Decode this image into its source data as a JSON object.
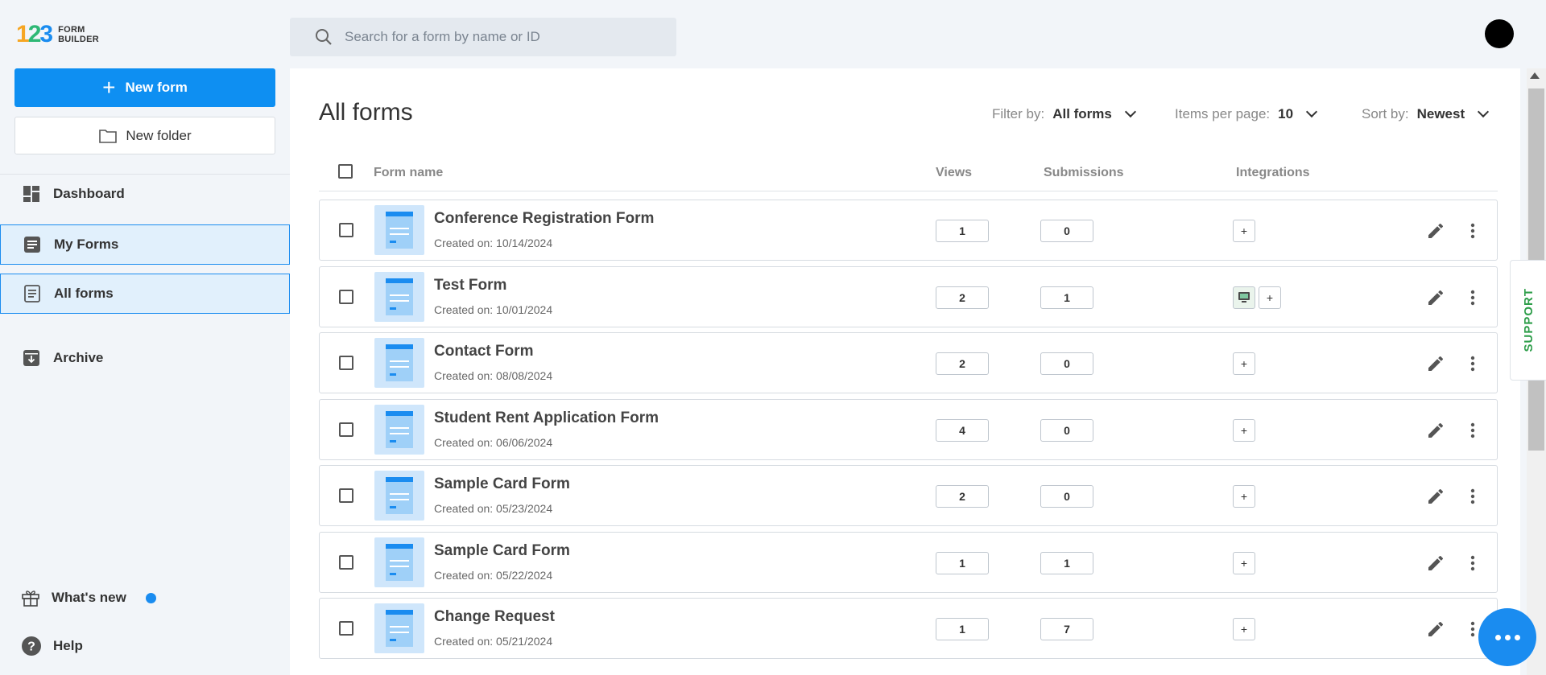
{
  "logo": {
    "number": "123",
    "line1": "FORM",
    "line2": "BUILDER"
  },
  "sidebar": {
    "new_form_label": "New form",
    "new_folder_label": "New folder",
    "nav": [
      {
        "label": "Dashboard",
        "icon": "dashboard-icon"
      },
      {
        "label": "My Forms",
        "icon": "forms-icon"
      },
      {
        "label": "All forms",
        "icon": "document-icon"
      },
      {
        "label": "Archive",
        "icon": "archive-icon"
      }
    ],
    "whats_new_label": "What's new",
    "help_label": "Help"
  },
  "search": {
    "placeholder": "Search for a form by name or ID"
  },
  "main": {
    "title": "All forms",
    "filter": {
      "label": "Filter by:",
      "value": "All forms"
    },
    "per_page": {
      "label": "Items per page:",
      "value": "10"
    },
    "sort": {
      "label": "Sort by:",
      "value": "Newest"
    },
    "columns": {
      "name": "Form name",
      "views": "Views",
      "submissions": "Submissions",
      "integrations": "Integrations"
    },
    "rows": [
      {
        "name": "Conference Registration Form",
        "created": "Created on: 10/14/2024",
        "views": "1",
        "submissions": "0",
        "has_integration": false
      },
      {
        "name": "Test Form",
        "created": "Created on: 10/01/2024",
        "views": "2",
        "submissions": "1",
        "has_integration": true
      },
      {
        "name": "Contact Form",
        "created": "Created on: 08/08/2024",
        "views": "2",
        "submissions": "0",
        "has_integration": false
      },
      {
        "name": "Student Rent Application Form",
        "created": "Created on: 06/06/2024",
        "views": "4",
        "submissions": "0",
        "has_integration": false
      },
      {
        "name": "Sample Card Form",
        "created": "Created on: 05/23/2024",
        "views": "2",
        "submissions": "0",
        "has_integration": false
      },
      {
        "name": "Sample Card Form",
        "created": "Created on: 05/22/2024",
        "views": "1",
        "submissions": "1",
        "has_integration": false
      },
      {
        "name": "Change Request",
        "created": "Created on: 05/21/2024",
        "views": "1",
        "submissions": "7",
        "has_integration": false
      }
    ],
    "add_integration_symbol": "+"
  },
  "support_label": "SUPPORT",
  "colors": {
    "accent": "#0e8ff2",
    "support": "#2e9e4a",
    "active_bg": "#e1f0fc"
  }
}
